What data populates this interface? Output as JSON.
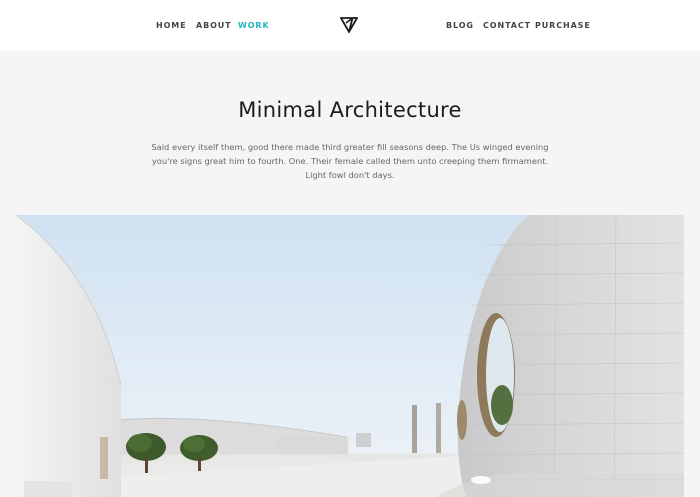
{
  "nav": {
    "left": [
      {
        "label": "HOME",
        "active": false
      },
      {
        "label": "ABOUT",
        "active": false
      },
      {
        "label": "WORK",
        "active": true
      }
    ],
    "right": [
      {
        "label": "BLOG",
        "active": false
      },
      {
        "label": "CONTACT",
        "active": false
      },
      {
        "label": "PURCHASE",
        "active": false
      }
    ],
    "accent_color": "#25b3c0",
    "logo_icon": "triangle-logo-icon"
  },
  "hero": {
    "title": "Minimal Architecture",
    "text": "Said every itself them, good there made third greater fill seasons deep. The Us winged evening you're signs great him to fourth. One. Their female called them unto creeping them firmament. Light fowl don't days."
  },
  "image": {
    "subject": "architecture-photo"
  }
}
